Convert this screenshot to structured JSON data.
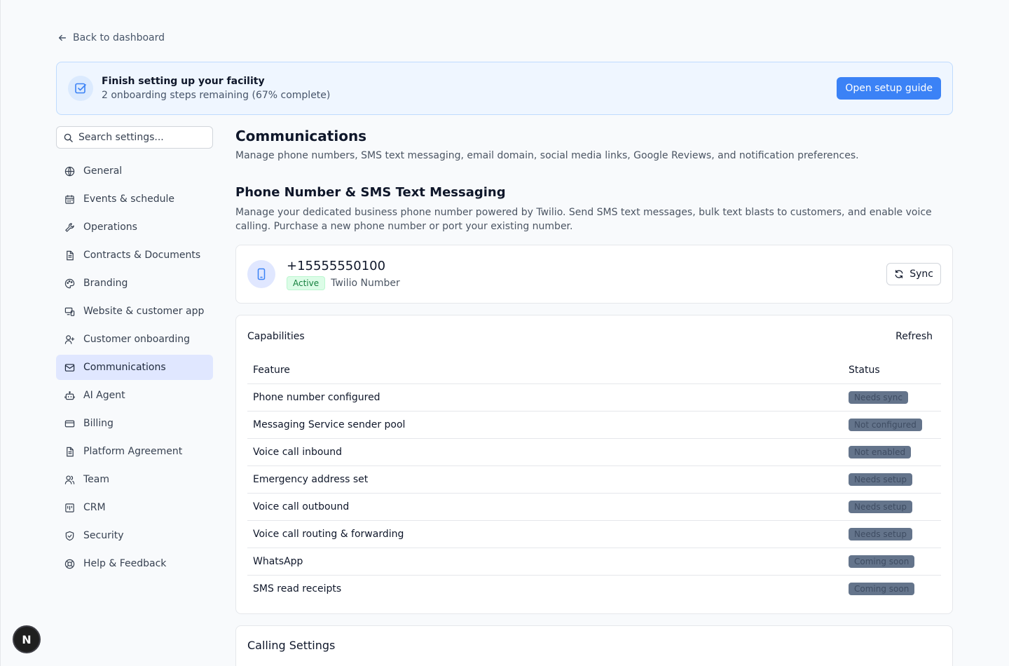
{
  "back_link": "Back to dashboard",
  "banner": {
    "title": "Finish setting up your facility",
    "subtitle": "2 onboarding steps remaining (67% complete)",
    "button": "Open setup guide"
  },
  "search": {
    "placeholder": "Search settings..."
  },
  "sidebar": {
    "items": [
      {
        "label": "General",
        "icon": "globe-icon"
      },
      {
        "label": "Events & schedule",
        "icon": "calendar-icon"
      },
      {
        "label": "Operations",
        "icon": "wrench-icon"
      },
      {
        "label": "Contracts & Documents",
        "icon": "document-icon"
      },
      {
        "label": "Branding",
        "icon": "palette-icon"
      },
      {
        "label": "Website & customer app",
        "icon": "devices-icon"
      },
      {
        "label": "Customer onboarding",
        "icon": "user-plus-icon"
      },
      {
        "label": "Communications",
        "icon": "mail-icon",
        "active": true
      },
      {
        "label": "AI Agent",
        "icon": "bot-icon"
      },
      {
        "label": "Billing",
        "icon": "card-icon"
      },
      {
        "label": "Platform Agreement",
        "icon": "document-icon"
      },
      {
        "label": "Team",
        "icon": "users-icon"
      },
      {
        "label": "CRM",
        "icon": "crm-icon"
      },
      {
        "label": "Security",
        "icon": "shield-icon"
      },
      {
        "label": "Help & Feedback",
        "icon": "lifebuoy-icon"
      }
    ]
  },
  "main": {
    "title": "Communications",
    "description": "Manage phone numbers, SMS text messaging, email domain, social media links, Google Reviews, and notification preferences.",
    "section_title": "Phone Number & SMS Text Messaging",
    "section_description": "Manage your dedicated business phone number powered by Twilio. Send SMS text messages, bulk text blasts to customers, and enable voice calling. Purchase a new phone number or port your existing number.",
    "phone": {
      "number": "+15555550100",
      "status": "Active",
      "type": "Twilio Number",
      "sync_label": "Sync"
    },
    "capabilities": {
      "title": "Capabilities",
      "refresh_label": "Refresh",
      "columns": [
        "Feature",
        "Status"
      ],
      "rows": [
        {
          "feature": "Phone number configured",
          "status": "Needs sync"
        },
        {
          "feature": "Messaging Service sender pool",
          "status": "Not configured"
        },
        {
          "feature": "Voice call inbound",
          "status": "Not enabled"
        },
        {
          "feature": "Emergency address set",
          "status": "Needs setup"
        },
        {
          "feature": "Voice call outbound",
          "status": "Needs setup"
        },
        {
          "feature": "Voice call routing & forwarding",
          "status": "Needs setup"
        },
        {
          "feature": "WhatsApp",
          "status": "Coming soon"
        },
        {
          "feature": "SMS read receipts",
          "status": "Coming soon"
        }
      ]
    },
    "calling": {
      "title": "Calling Settings"
    }
  },
  "dev_badge": "N",
  "colors": {
    "accent": "#3b82f6",
    "active_nav": "#e0e7ff",
    "badge_bg": "#64748b"
  }
}
